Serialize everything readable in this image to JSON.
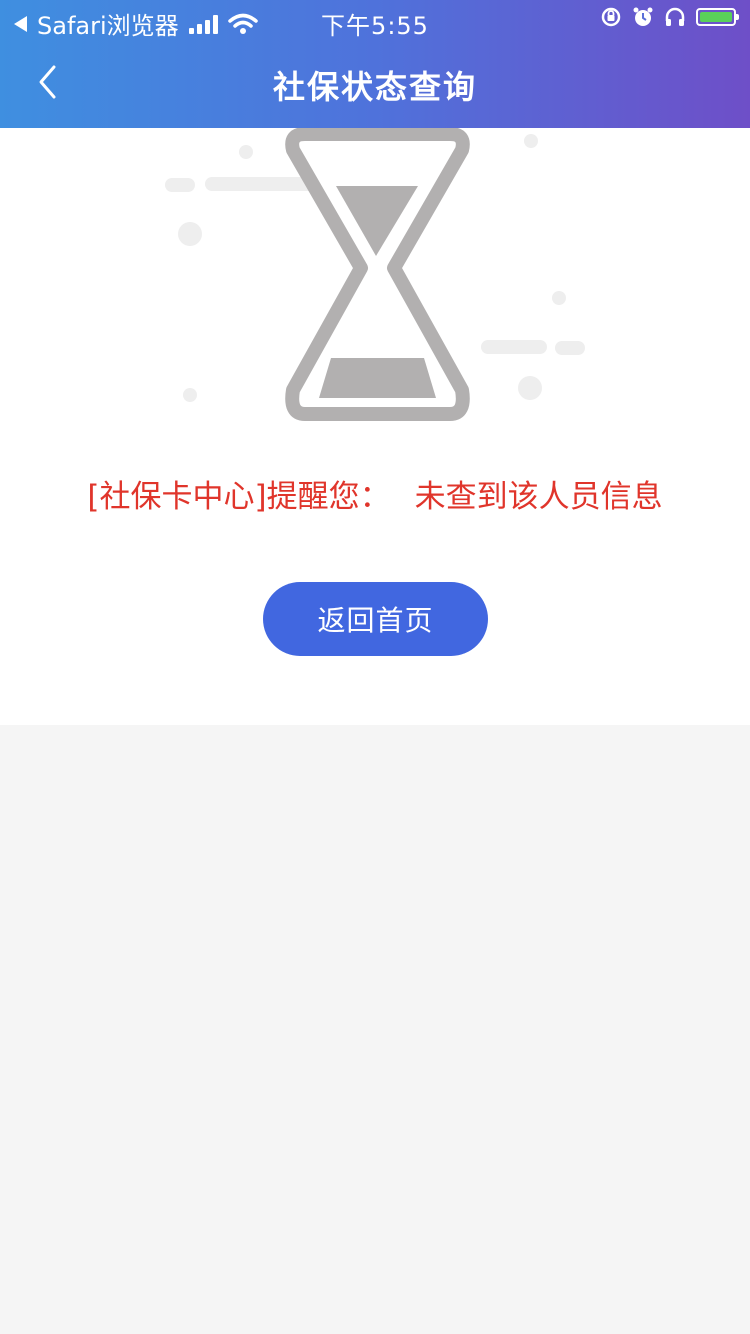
{
  "status_bar": {
    "back_app": "Safari浏览器",
    "time": "下午5:55"
  },
  "nav": {
    "title": "社保状态查询"
  },
  "content": {
    "notice_prefix": "[社保卡中心]提醒您：",
    "notice_message": "未查到该人员信息",
    "home_button_label": "返回首页"
  },
  "colors": {
    "header_gradient_start": "#3f8fe0",
    "header_gradient_end": "#6e4fc8",
    "message_red": "#e0352b",
    "button_blue": "#4167e0",
    "page_background": "#f5f5f5"
  },
  "icons": {
    "back": "chevron-left-icon",
    "illustration": "hourglass-icon"
  }
}
